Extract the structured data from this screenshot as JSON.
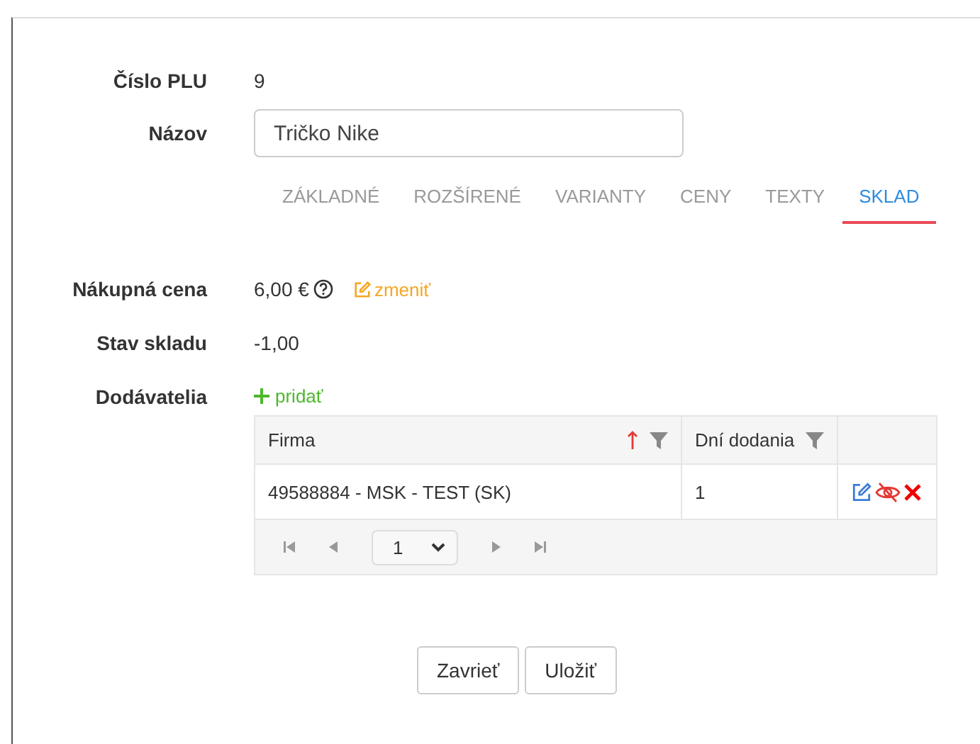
{
  "fields": [
    {
      "label": "Číslo PLU",
      "value": "9"
    }
  ],
  "name_field": {
    "label": "Názov",
    "value": "Tričko Nike"
  },
  "tabs": [
    {
      "label": "ZÁKLADNÉ",
      "selected": false
    },
    {
      "label": "ROZŠÍRENÉ",
      "selected": false
    },
    {
      "label": "VARIANTY",
      "selected": false
    },
    {
      "label": "CENY",
      "selected": false
    },
    {
      "label": "TEXTY",
      "selected": false
    },
    {
      "label": "SKLAD",
      "selected": true
    }
  ],
  "purchase_price": {
    "label": "Nákupná cena",
    "value": "6,00 €",
    "change_link": "zmeniť"
  },
  "stock": {
    "label": "Stav skladu",
    "value": "-1,00"
  },
  "suppliers": {
    "label": "Dodávatelia",
    "add_link": "pridať",
    "columns": [
      {
        "label": "Firma",
        "sorted": true
      },
      {
        "label": "Dní dodania",
        "sorted": false
      }
    ],
    "rows": [
      {
        "firma": "49588884 - MSK - TEST (SK)",
        "days": "1"
      }
    ],
    "page": "1"
  },
  "buttons": [
    "Zavrieť",
    "Uložiť"
  ]
}
